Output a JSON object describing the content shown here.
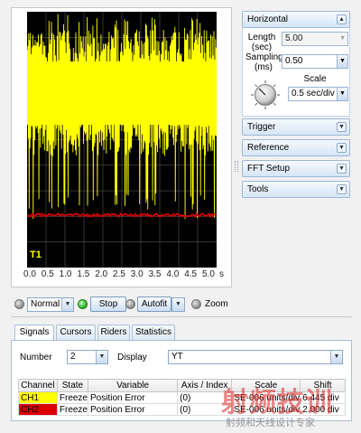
{
  "scope": {
    "time_ticks": [
      "0.0",
      "0.5",
      "1.0",
      "1.5",
      "2.0",
      "2.5",
      "3.0",
      "3.5",
      "4.0",
      "4.5",
      "5.0"
    ],
    "time_unit": "s",
    "trace_label": "T1",
    "trace_colors": {
      "ch1": "#ffff00",
      "ch2": "#cc0000",
      "grid": "#555555",
      "background": "#000000"
    }
  },
  "toolbar": {
    "mode_value": "Normal",
    "stop_label": "Stop",
    "autofit_label": "Autofit",
    "zoom_label": "Zoom"
  },
  "panels": {
    "horizontal": {
      "title": "Horizontal",
      "length_label": "Length (sec)",
      "length_value": "5.00",
      "sampling_label": "Sampling (ms)",
      "sampling_value": "0.50",
      "scale_label": "Scale",
      "scale_value": "0.5 sec/div"
    },
    "trigger": {
      "title": "Trigger"
    },
    "reference": {
      "title": "Reference"
    },
    "fft": {
      "title": "FFT Setup"
    },
    "tools": {
      "title": "Tools"
    }
  },
  "tabs": [
    {
      "label": "Signals",
      "active": true
    },
    {
      "label": "Cursors",
      "active": false
    },
    {
      "label": "Riders",
      "active": false
    },
    {
      "label": "Statistics",
      "active": false
    }
  ],
  "signals": {
    "number_label": "Number",
    "number_value": "2",
    "display_label": "Display",
    "display_value": "YT",
    "columns": [
      "Channel",
      "State",
      "Variable",
      "Axis / Index",
      "Scale",
      "Shift"
    ],
    "rows": [
      {
        "channel": "CH1",
        "state": "Freeze",
        "variable": "Position Error",
        "axis": "(0)",
        "scale": "SE-006 units/div",
        "shift": "6.445 div",
        "color": "#ffff00"
      },
      {
        "channel": "CH2",
        "state": "Freeze",
        "variable": "Position Error",
        "axis": "(0)",
        "scale": "SE-006 units/div",
        "shift": "2.000 div",
        "color": "#dd0000"
      }
    ]
  },
  "watermark": {
    "big": "射频技训",
    "small": "射频和天线设计专家"
  }
}
